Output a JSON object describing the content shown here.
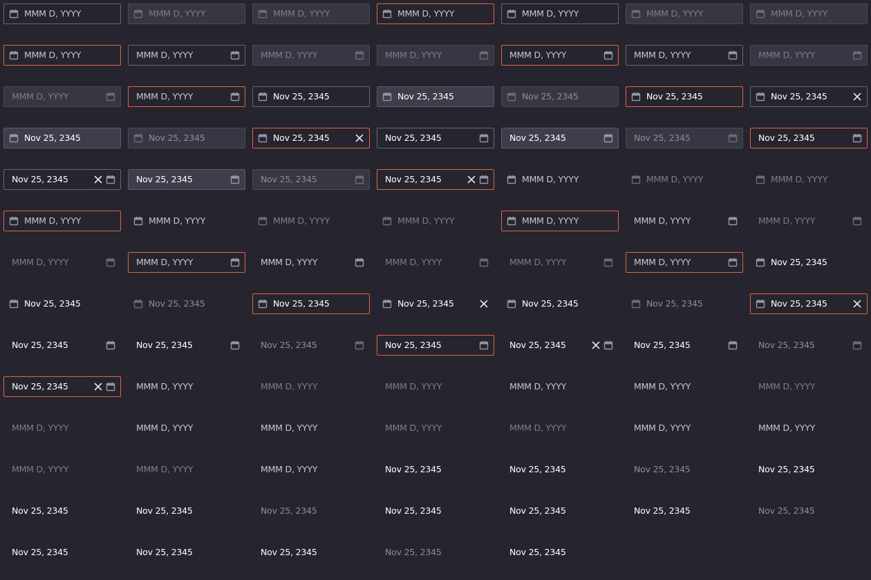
{
  "placeholder": "MMM D, YYYY",
  "date_value": "Nov 25, 2345",
  "colors": {
    "background": "#25242f",
    "error_border": "#e5653f",
    "outline_border": "#6a6876",
    "filled_background": "#3e3d4b",
    "text": "#ffffff",
    "placeholder_text": "#c9c7d0",
    "disabled_text": "#7f7d8a"
  },
  "icons": {
    "calendar": "calendar-icon",
    "clear": "close-icon"
  },
  "rows": [
    [
      {
        "v": "outline",
        "icon": "left",
        "val": false,
        "dis": false,
        "err": false,
        "clr": false
      },
      {
        "v": "filled",
        "icon": "left",
        "val": false,
        "dis": true,
        "err": false,
        "clr": false
      },
      {
        "v": "filled",
        "icon": "left",
        "val": false,
        "dis": true,
        "err": false,
        "clr": false
      },
      {
        "v": "outline",
        "icon": "left",
        "val": false,
        "dis": false,
        "err": true,
        "clr": false
      },
      {
        "v": "outline",
        "icon": "left",
        "val": false,
        "dis": false,
        "err": false,
        "clr": false
      },
      {
        "v": "filled",
        "icon": "left",
        "val": false,
        "dis": true,
        "err": false,
        "clr": false
      },
      {
        "v": "filled",
        "icon": "left",
        "val": false,
        "dis": true,
        "err": false,
        "clr": false
      }
    ],
    [
      {
        "v": "outline",
        "icon": "left",
        "val": false,
        "dis": false,
        "err": true,
        "clr": false
      },
      {
        "v": "outline",
        "icon": "right",
        "val": false,
        "dis": false,
        "err": false,
        "clr": false
      },
      {
        "v": "filled",
        "icon": "right",
        "val": false,
        "dis": true,
        "err": false,
        "clr": false
      },
      {
        "v": "filled",
        "icon": "right",
        "val": false,
        "dis": true,
        "err": false,
        "clr": false
      },
      {
        "v": "outline",
        "icon": "right",
        "val": false,
        "dis": false,
        "err": true,
        "clr": false
      },
      {
        "v": "outline",
        "icon": "right",
        "val": false,
        "dis": false,
        "err": false,
        "clr": false
      },
      {
        "v": "filled",
        "icon": "right",
        "val": false,
        "dis": true,
        "err": false,
        "clr": false
      }
    ],
    [
      {
        "v": "filled",
        "icon": "right",
        "val": false,
        "dis": true,
        "err": false,
        "clr": false
      },
      {
        "v": "outline",
        "icon": "right",
        "val": false,
        "dis": false,
        "err": true,
        "clr": false
      },
      {
        "v": "outline",
        "icon": "left",
        "val": true,
        "dis": false,
        "err": false,
        "clr": false
      },
      {
        "v": "filled",
        "icon": "left",
        "val": true,
        "dis": false,
        "err": false,
        "clr": false
      },
      {
        "v": "filled",
        "icon": "left",
        "val": true,
        "dis": true,
        "err": false,
        "clr": false
      },
      {
        "v": "outline",
        "icon": "left",
        "val": true,
        "dis": false,
        "err": true,
        "clr": false
      },
      {
        "v": "outline",
        "icon": "left",
        "val": true,
        "dis": false,
        "err": false,
        "clr": true
      }
    ],
    [
      {
        "v": "filled",
        "icon": "left",
        "val": true,
        "dis": false,
        "err": false,
        "clr": false
      },
      {
        "v": "filled",
        "icon": "left",
        "val": true,
        "dis": true,
        "err": false,
        "clr": false
      },
      {
        "v": "outline",
        "icon": "left",
        "val": true,
        "dis": false,
        "err": true,
        "clr": true
      },
      {
        "v": "outline",
        "icon": "right",
        "val": true,
        "dis": false,
        "err": false,
        "clr": false
      },
      {
        "v": "filled",
        "icon": "right",
        "val": true,
        "dis": false,
        "err": false,
        "clr": false
      },
      {
        "v": "filled",
        "icon": "right",
        "val": true,
        "dis": true,
        "err": false,
        "clr": false
      },
      {
        "v": "outline",
        "icon": "right",
        "val": true,
        "dis": false,
        "err": true,
        "clr": false
      }
    ],
    [
      {
        "v": "outline",
        "icon": "right",
        "val": true,
        "dis": false,
        "err": false,
        "clr": true
      },
      {
        "v": "filled",
        "icon": "right",
        "val": true,
        "dis": false,
        "err": false,
        "clr": false
      },
      {
        "v": "filled",
        "icon": "right",
        "val": true,
        "dis": true,
        "err": false,
        "clr": false
      },
      {
        "v": "outline",
        "icon": "right",
        "val": true,
        "dis": false,
        "err": true,
        "clr": true
      },
      {
        "v": "plain",
        "icon": "left",
        "val": false,
        "dis": false,
        "err": false,
        "clr": false
      },
      {
        "v": "plain",
        "icon": "left",
        "val": false,
        "dis": true,
        "err": false,
        "clr": false
      },
      {
        "v": "plain",
        "icon": "left",
        "val": false,
        "dis": true,
        "err": false,
        "clr": false
      }
    ],
    [
      {
        "v": "plain",
        "icon": "left",
        "val": false,
        "dis": false,
        "err": true,
        "clr": false
      },
      {
        "v": "plain",
        "icon": "left",
        "val": false,
        "dis": false,
        "err": false,
        "clr": false
      },
      {
        "v": "plain",
        "icon": "left",
        "val": false,
        "dis": true,
        "err": false,
        "clr": false
      },
      {
        "v": "plain",
        "icon": "left",
        "val": false,
        "dis": true,
        "err": false,
        "clr": false
      },
      {
        "v": "plain",
        "icon": "left",
        "val": false,
        "dis": false,
        "err": true,
        "clr": false
      },
      {
        "v": "plain",
        "icon": "right",
        "val": false,
        "dis": false,
        "err": false,
        "clr": false
      },
      {
        "v": "plain",
        "icon": "right",
        "val": false,
        "dis": true,
        "err": false,
        "clr": false
      }
    ],
    [
      {
        "v": "plain",
        "icon": "right",
        "val": false,
        "dis": true,
        "err": false,
        "clr": false
      },
      {
        "v": "plain",
        "icon": "right",
        "val": false,
        "dis": false,
        "err": true,
        "clr": false
      },
      {
        "v": "plain",
        "icon": "right",
        "val": false,
        "dis": false,
        "err": false,
        "clr": false
      },
      {
        "v": "plain",
        "icon": "right",
        "val": false,
        "dis": true,
        "err": false,
        "clr": false
      },
      {
        "v": "plain",
        "icon": "right",
        "val": false,
        "dis": true,
        "err": false,
        "clr": false
      },
      {
        "v": "plain",
        "icon": "right",
        "val": false,
        "dis": false,
        "err": true,
        "clr": false
      },
      {
        "v": "plain",
        "icon": "left",
        "val": true,
        "dis": false,
        "err": false,
        "clr": false
      }
    ],
    [
      {
        "v": "plain",
        "icon": "left",
        "val": true,
        "dis": false,
        "err": false,
        "clr": false
      },
      {
        "v": "plain",
        "icon": "left",
        "val": true,
        "dis": true,
        "err": false,
        "clr": false
      },
      {
        "v": "plain",
        "icon": "left",
        "val": true,
        "dis": false,
        "err": true,
        "clr": false
      },
      {
        "v": "plain",
        "icon": "left",
        "val": true,
        "dis": false,
        "err": false,
        "clr": true
      },
      {
        "v": "plain",
        "icon": "left",
        "val": true,
        "dis": false,
        "err": false,
        "clr": false
      },
      {
        "v": "plain",
        "icon": "left",
        "val": true,
        "dis": true,
        "err": false,
        "clr": false
      },
      {
        "v": "plain",
        "icon": "left",
        "val": true,
        "dis": false,
        "err": true,
        "clr": true
      }
    ],
    [
      {
        "v": "plain",
        "icon": "right",
        "val": true,
        "dis": false,
        "err": false,
        "clr": false
      },
      {
        "v": "plain",
        "icon": "right",
        "val": true,
        "dis": false,
        "err": false,
        "clr": false
      },
      {
        "v": "plain",
        "icon": "right",
        "val": true,
        "dis": true,
        "err": false,
        "clr": false
      },
      {
        "v": "plain",
        "icon": "right",
        "val": true,
        "dis": false,
        "err": true,
        "clr": false
      },
      {
        "v": "plain",
        "icon": "right",
        "val": true,
        "dis": false,
        "err": false,
        "clr": true
      },
      {
        "v": "plain",
        "icon": "right",
        "val": true,
        "dis": false,
        "err": false,
        "clr": false
      },
      {
        "v": "plain",
        "icon": "right",
        "val": true,
        "dis": true,
        "err": false,
        "clr": false
      }
    ],
    [
      {
        "v": "plain",
        "icon": "right",
        "val": true,
        "dis": false,
        "err": true,
        "clr": true
      },
      {
        "v": "plain",
        "icon": "none",
        "val": false,
        "dis": false,
        "err": false,
        "clr": false
      },
      {
        "v": "plain",
        "icon": "none",
        "val": false,
        "dis": true,
        "err": false,
        "clr": false
      },
      {
        "v": "plain",
        "icon": "none",
        "val": false,
        "dis": true,
        "err": false,
        "clr": false
      },
      {
        "v": "plain",
        "icon": "none",
        "val": false,
        "dis": false,
        "err": false,
        "clr": false
      },
      {
        "v": "plain",
        "icon": "none",
        "val": false,
        "dis": false,
        "err": false,
        "clr": false
      },
      {
        "v": "plain",
        "icon": "none",
        "val": false,
        "dis": true,
        "err": false,
        "clr": false
      }
    ],
    [
      {
        "v": "plain",
        "icon": "none",
        "val": false,
        "dis": true,
        "err": false,
        "clr": false
      },
      {
        "v": "plain",
        "icon": "none",
        "val": false,
        "dis": false,
        "err": false,
        "clr": false
      },
      {
        "v": "plain",
        "icon": "none",
        "val": false,
        "dis": false,
        "err": false,
        "clr": false
      },
      {
        "v": "plain",
        "icon": "none",
        "val": false,
        "dis": true,
        "err": false,
        "clr": false
      },
      {
        "v": "plain",
        "icon": "none",
        "val": false,
        "dis": true,
        "err": false,
        "clr": false
      },
      {
        "v": "plain",
        "icon": "none",
        "val": false,
        "dis": false,
        "err": false,
        "clr": false
      },
      {
        "v": "plain",
        "icon": "none",
        "val": false,
        "dis": false,
        "err": false,
        "clr": false
      }
    ],
    [
      {
        "v": "plain",
        "icon": "none",
        "val": false,
        "dis": true,
        "err": false,
        "clr": false
      },
      {
        "v": "plain",
        "icon": "none",
        "val": false,
        "dis": true,
        "err": false,
        "clr": false
      },
      {
        "v": "plain",
        "icon": "none",
        "val": false,
        "dis": false,
        "err": false,
        "clr": false
      },
      {
        "v": "plain",
        "icon": "none",
        "val": true,
        "dis": false,
        "err": false,
        "clr": false
      },
      {
        "v": "plain",
        "icon": "none",
        "val": true,
        "dis": false,
        "err": false,
        "clr": false
      },
      {
        "v": "plain",
        "icon": "none",
        "val": true,
        "dis": true,
        "err": false,
        "clr": false
      },
      {
        "v": "plain",
        "icon": "none",
        "val": true,
        "dis": false,
        "err": false,
        "clr": false
      }
    ],
    [
      {
        "v": "plain",
        "icon": "none",
        "val": true,
        "dis": false,
        "err": false,
        "clr": false
      },
      {
        "v": "plain",
        "icon": "none",
        "val": true,
        "dis": false,
        "err": false,
        "clr": false
      },
      {
        "v": "plain",
        "icon": "none",
        "val": true,
        "dis": true,
        "err": false,
        "clr": false
      },
      {
        "v": "plain",
        "icon": "none",
        "val": true,
        "dis": false,
        "err": false,
        "clr": false
      },
      {
        "v": "plain",
        "icon": "none",
        "val": true,
        "dis": false,
        "err": false,
        "clr": false
      },
      {
        "v": "plain",
        "icon": "none",
        "val": true,
        "dis": false,
        "err": false,
        "clr": false
      },
      {
        "v": "plain",
        "icon": "none",
        "val": true,
        "dis": true,
        "err": false,
        "clr": false
      }
    ],
    [
      {
        "v": "plain",
        "icon": "none",
        "val": true,
        "dis": false,
        "err": false,
        "clr": false
      },
      {
        "v": "plain",
        "icon": "none",
        "val": true,
        "dis": false,
        "err": false,
        "clr": false
      },
      {
        "v": "plain",
        "icon": "none",
        "val": true,
        "dis": false,
        "err": false,
        "clr": false
      },
      {
        "v": "plain",
        "icon": "none",
        "val": true,
        "dis": true,
        "err": false,
        "clr": false
      },
      {
        "v": "plain",
        "icon": "none",
        "val": true,
        "dis": false,
        "err": false,
        "clr": false
      }
    ]
  ]
}
